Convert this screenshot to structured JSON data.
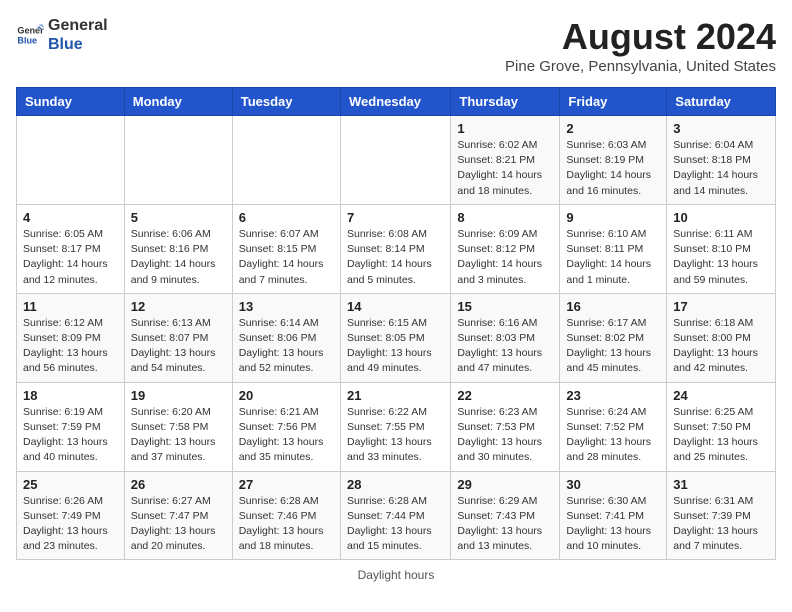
{
  "header": {
    "logo_line1": "General",
    "logo_line2": "Blue",
    "month_title": "August 2024",
    "subtitle": "Pine Grove, Pennsylvania, United States"
  },
  "days_of_week": [
    "Sunday",
    "Monday",
    "Tuesday",
    "Wednesday",
    "Thursday",
    "Friday",
    "Saturday"
  ],
  "weeks": [
    [
      {
        "day": "",
        "info": ""
      },
      {
        "day": "",
        "info": ""
      },
      {
        "day": "",
        "info": ""
      },
      {
        "day": "",
        "info": ""
      },
      {
        "day": "1",
        "info": "Sunrise: 6:02 AM\nSunset: 8:21 PM\nDaylight: 14 hours\nand 18 minutes."
      },
      {
        "day": "2",
        "info": "Sunrise: 6:03 AM\nSunset: 8:19 PM\nDaylight: 14 hours\nand 16 minutes."
      },
      {
        "day": "3",
        "info": "Sunrise: 6:04 AM\nSunset: 8:18 PM\nDaylight: 14 hours\nand 14 minutes."
      }
    ],
    [
      {
        "day": "4",
        "info": "Sunrise: 6:05 AM\nSunset: 8:17 PM\nDaylight: 14 hours\nand 12 minutes."
      },
      {
        "day": "5",
        "info": "Sunrise: 6:06 AM\nSunset: 8:16 PM\nDaylight: 14 hours\nand 9 minutes."
      },
      {
        "day": "6",
        "info": "Sunrise: 6:07 AM\nSunset: 8:15 PM\nDaylight: 14 hours\nand 7 minutes."
      },
      {
        "day": "7",
        "info": "Sunrise: 6:08 AM\nSunset: 8:14 PM\nDaylight: 14 hours\nand 5 minutes."
      },
      {
        "day": "8",
        "info": "Sunrise: 6:09 AM\nSunset: 8:12 PM\nDaylight: 14 hours\nand 3 minutes."
      },
      {
        "day": "9",
        "info": "Sunrise: 6:10 AM\nSunset: 8:11 PM\nDaylight: 14 hours\nand 1 minute."
      },
      {
        "day": "10",
        "info": "Sunrise: 6:11 AM\nSunset: 8:10 PM\nDaylight: 13 hours\nand 59 minutes."
      }
    ],
    [
      {
        "day": "11",
        "info": "Sunrise: 6:12 AM\nSunset: 8:09 PM\nDaylight: 13 hours\nand 56 minutes."
      },
      {
        "day": "12",
        "info": "Sunrise: 6:13 AM\nSunset: 8:07 PM\nDaylight: 13 hours\nand 54 minutes."
      },
      {
        "day": "13",
        "info": "Sunrise: 6:14 AM\nSunset: 8:06 PM\nDaylight: 13 hours\nand 52 minutes."
      },
      {
        "day": "14",
        "info": "Sunrise: 6:15 AM\nSunset: 8:05 PM\nDaylight: 13 hours\nand 49 minutes."
      },
      {
        "day": "15",
        "info": "Sunrise: 6:16 AM\nSunset: 8:03 PM\nDaylight: 13 hours\nand 47 minutes."
      },
      {
        "day": "16",
        "info": "Sunrise: 6:17 AM\nSunset: 8:02 PM\nDaylight: 13 hours\nand 45 minutes."
      },
      {
        "day": "17",
        "info": "Sunrise: 6:18 AM\nSunset: 8:00 PM\nDaylight: 13 hours\nand 42 minutes."
      }
    ],
    [
      {
        "day": "18",
        "info": "Sunrise: 6:19 AM\nSunset: 7:59 PM\nDaylight: 13 hours\nand 40 minutes."
      },
      {
        "day": "19",
        "info": "Sunrise: 6:20 AM\nSunset: 7:58 PM\nDaylight: 13 hours\nand 37 minutes."
      },
      {
        "day": "20",
        "info": "Sunrise: 6:21 AM\nSunset: 7:56 PM\nDaylight: 13 hours\nand 35 minutes."
      },
      {
        "day": "21",
        "info": "Sunrise: 6:22 AM\nSunset: 7:55 PM\nDaylight: 13 hours\nand 33 minutes."
      },
      {
        "day": "22",
        "info": "Sunrise: 6:23 AM\nSunset: 7:53 PM\nDaylight: 13 hours\nand 30 minutes."
      },
      {
        "day": "23",
        "info": "Sunrise: 6:24 AM\nSunset: 7:52 PM\nDaylight: 13 hours\nand 28 minutes."
      },
      {
        "day": "24",
        "info": "Sunrise: 6:25 AM\nSunset: 7:50 PM\nDaylight: 13 hours\nand 25 minutes."
      }
    ],
    [
      {
        "day": "25",
        "info": "Sunrise: 6:26 AM\nSunset: 7:49 PM\nDaylight: 13 hours\nand 23 minutes."
      },
      {
        "day": "26",
        "info": "Sunrise: 6:27 AM\nSunset: 7:47 PM\nDaylight: 13 hours\nand 20 minutes."
      },
      {
        "day": "27",
        "info": "Sunrise: 6:28 AM\nSunset: 7:46 PM\nDaylight: 13 hours\nand 18 minutes."
      },
      {
        "day": "28",
        "info": "Sunrise: 6:28 AM\nSunset: 7:44 PM\nDaylight: 13 hours\nand 15 minutes."
      },
      {
        "day": "29",
        "info": "Sunrise: 6:29 AM\nSunset: 7:43 PM\nDaylight: 13 hours\nand 13 minutes."
      },
      {
        "day": "30",
        "info": "Sunrise: 6:30 AM\nSunset: 7:41 PM\nDaylight: 13 hours\nand 10 minutes."
      },
      {
        "day": "31",
        "info": "Sunrise: 6:31 AM\nSunset: 7:39 PM\nDaylight: 13 hours\nand 7 minutes."
      }
    ]
  ],
  "footer": "Daylight hours"
}
